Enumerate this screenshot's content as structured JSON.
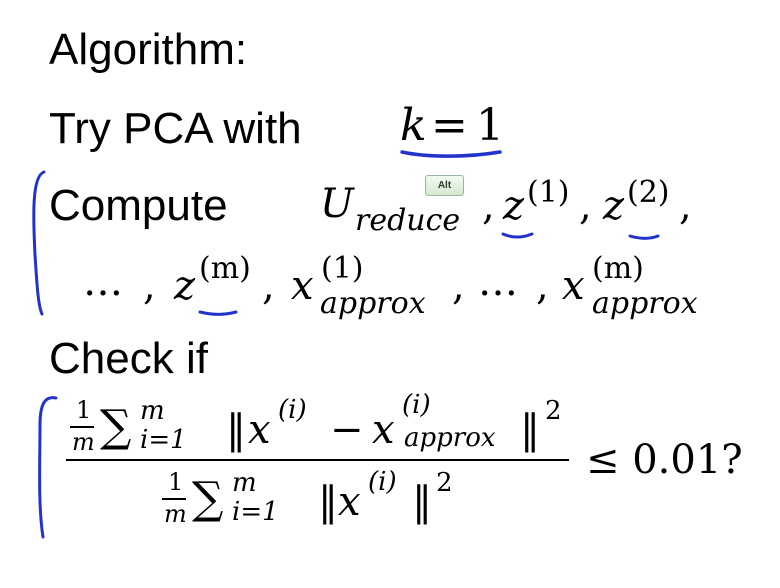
{
  "slide": {
    "line1": "Algorithm:",
    "line2_text": "Try PCA with",
    "line2_math": {
      "k": "k",
      "eq": "=",
      "one": "1"
    },
    "line3_text": "Compute",
    "line3_math": {
      "U": "U",
      "reduce": "reduce",
      "comma": ",",
      "z": "z",
      "sup1": "(1)",
      "sup2": "(2)"
    },
    "line4_math": {
      "dots": "…",
      "comma": ",",
      "z": "z",
      "supm": "(m)",
      "x": "x",
      "sup1": "(1)",
      "supm2": "(m)",
      "approx": "approx"
    },
    "line5": "Check if",
    "fraction": {
      "num_frac_top": "1",
      "num_frac_bot": "m",
      "sum": "∑",
      "upper": "m",
      "lower": "i=1",
      "norm_open": "‖",
      "x": "x",
      "supi": "(i)",
      "minus": "−",
      "approx": "approx",
      "norm_close": "‖",
      "sq": "2",
      "rhs": "≤ 0.01?"
    }
  },
  "tooltip": {
    "label": "Alt"
  },
  "ink_color": "#2233cc"
}
